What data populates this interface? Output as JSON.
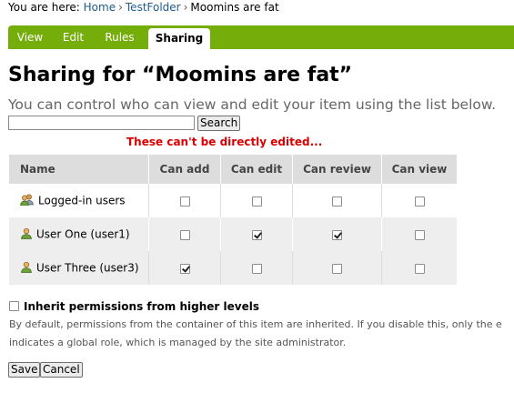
{
  "breadcrumb": {
    "prefix": "You are here:",
    "items": [
      "Home",
      "TestFolder",
      "Moomins are fat"
    ],
    "separator": "›"
  },
  "tabs": [
    {
      "label": "View",
      "active": false
    },
    {
      "label": "Edit",
      "active": false
    },
    {
      "label": "Rules",
      "active": false
    },
    {
      "label": "Sharing",
      "active": true
    }
  ],
  "title": "Sharing for “Moomins are fat”",
  "subtitle": "You can control who can view and edit your item using the list below.",
  "search": {
    "value": "",
    "button_label": "Search"
  },
  "notice": "These can't be directly edited...",
  "table": {
    "headers": [
      "Name",
      "Can add",
      "Can edit",
      "Can review",
      "Can view"
    ],
    "rows": [
      {
        "name": "Logged-in users",
        "icon": "group-icon",
        "perms": [
          false,
          false,
          false,
          false
        ]
      },
      {
        "name": "User One (user1)",
        "icon": "user-icon",
        "perms": [
          false,
          true,
          true,
          false
        ]
      },
      {
        "name": "User Three (user3)",
        "icon": "user-icon",
        "perms": [
          true,
          false,
          false,
          false
        ]
      }
    ]
  },
  "inherit": {
    "label": "Inherit permissions from higher levels",
    "checked": false,
    "help_line1": "By default, permissions from the container of this item are inherited. If you disable this, only the e",
    "help_line2": "indicates a global role, which is managed by the site administrator."
  },
  "buttons": {
    "save": "Save",
    "cancel": "Cancel"
  },
  "colors": {
    "tabbar": "#75ad0a",
    "link": "#205c90",
    "notice": "#dd0000",
    "header_bg": "#dddddd"
  }
}
